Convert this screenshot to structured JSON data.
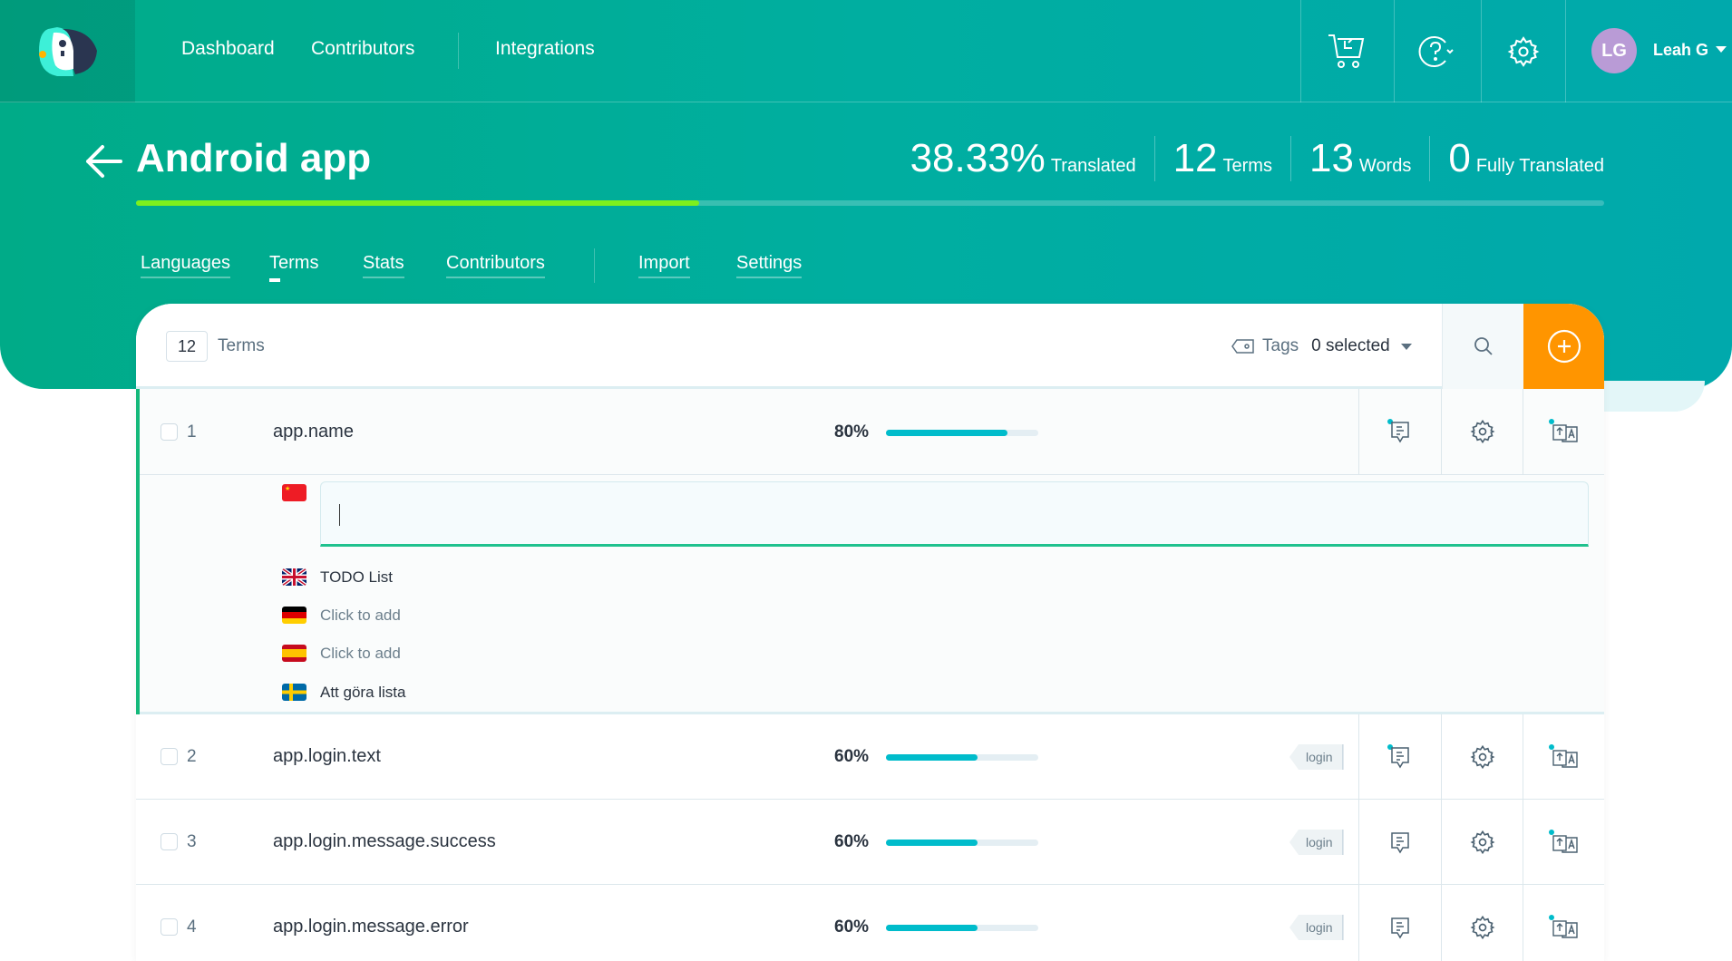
{
  "nav": {
    "items": [
      "Dashboard",
      "Contributors",
      "Integrations"
    ]
  },
  "user": {
    "initials": "LG",
    "name": "Leah G",
    "avatar_color": "#b99bd6"
  },
  "project": {
    "title": "Android app",
    "translated_pct": "38.33%",
    "translated_label": "Translated",
    "terms": "12",
    "terms_label": "Terms",
    "words": "13",
    "words_label": "Words",
    "fully": "0",
    "fully_label": "Fully Translated",
    "progress": 38.33
  },
  "tabs": [
    "Languages",
    "Terms",
    "Stats",
    "Contributors",
    "Import",
    "Settings"
  ],
  "active_tab": "Terms",
  "toolbar": {
    "count": "12",
    "count_label": "Terms",
    "tags_label": "Tags",
    "tags_value": "0 selected"
  },
  "colors": {
    "accent": "#00ab88",
    "add_button": "#ff9500",
    "progress": "#7df01c",
    "term_bar": "#00bccb"
  },
  "terms": [
    {
      "n": "1",
      "key": "app.name",
      "pct": "80%",
      "value": 80,
      "tag": ""
    },
    {
      "n": "2",
      "key": "app.login.text",
      "pct": "60%",
      "value": 60,
      "tag": "login"
    },
    {
      "n": "3",
      "key": "app.login.message.success",
      "pct": "60%",
      "value": 60,
      "tag": "login"
    },
    {
      "n": "4",
      "key": "app.login.message.error",
      "pct": "60%",
      "value": 60,
      "tag": "login"
    }
  ],
  "expanded": {
    "editing_flag": "cn",
    "languages": [
      {
        "flag": "gb",
        "text": "TODO List",
        "placeholder": false
      },
      {
        "flag": "de",
        "text": "Click to add",
        "placeholder": true
      },
      {
        "flag": "es",
        "text": "Click to add",
        "placeholder": true
      },
      {
        "flag": "se",
        "text": "Att göra lista",
        "placeholder": false
      }
    ]
  }
}
